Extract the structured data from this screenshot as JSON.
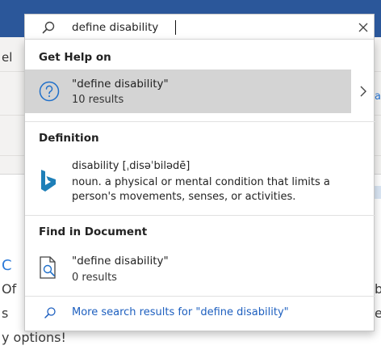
{
  "search": {
    "value": "define disability",
    "clear_icon": "close-icon",
    "search_icon": "search-icon"
  },
  "get_help": {
    "heading": "Get Help on",
    "item_title": "\"define disability\"",
    "item_subtitle": "10 results",
    "icon": "question-circle-icon",
    "chevron_icon": "chevron-right-icon"
  },
  "definition": {
    "heading": "Definition",
    "term": "disability [ˌdisəˈbilədē]",
    "text": "noun. a physical or mental condition that limits a person's movements, senses, or activities.",
    "icon": "bing-logo-icon"
  },
  "find_in_document": {
    "heading": "Find in Document",
    "item_title": "\"define disability\"",
    "item_subtitle": "0 results",
    "icon": "document-search-icon"
  },
  "more_results": {
    "label": "More search results for \"define disability\"",
    "icon": "search-icon"
  },
  "background": {
    "left_fragments": [
      "el",
      "C",
      "Of",
      "s",
      "y options!"
    ],
    "right_fragments": [
      "b",
      "ev",
      "ab"
    ],
    "colors": {
      "titlebar": "#2b579a",
      "link": "#1d5fbf",
      "selected_row": "#d4d4d4"
    }
  }
}
